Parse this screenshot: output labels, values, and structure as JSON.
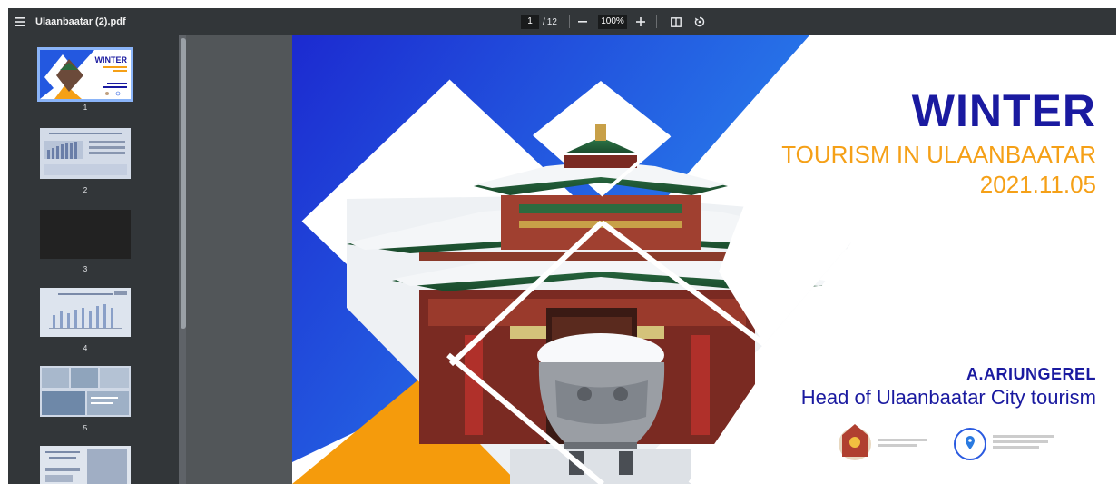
{
  "toolbar": {
    "file_title": "Ulaanbaatar (2).pdf",
    "page_current": "1",
    "page_separator": "/",
    "page_total": "12",
    "zoom": "100%",
    "icons": {
      "menu": "menu-icon",
      "zoom_out": "minus-icon",
      "zoom_in": "plus-icon",
      "fit": "fit-page-icon",
      "rotate": "rotate-icon"
    }
  },
  "sidebar": {
    "thumbnails": [
      {
        "number": "1"
      },
      {
        "number": "2"
      },
      {
        "number": "3"
      },
      {
        "number": "4"
      },
      {
        "number": "5"
      }
    ]
  },
  "slide": {
    "title": "WINTER",
    "subtitle": "TOURISM IN ULAANBAATAR",
    "date": "2021.11.05",
    "presenter": "A.ARIUNGEREL",
    "role": "Head of Ulaanbaatar City tourism",
    "colors": {
      "blue": "#1a1aa0",
      "orange": "#f5a017",
      "gradient_start": "#1c2ad0",
      "gradient_end": "#2a8af0"
    }
  }
}
